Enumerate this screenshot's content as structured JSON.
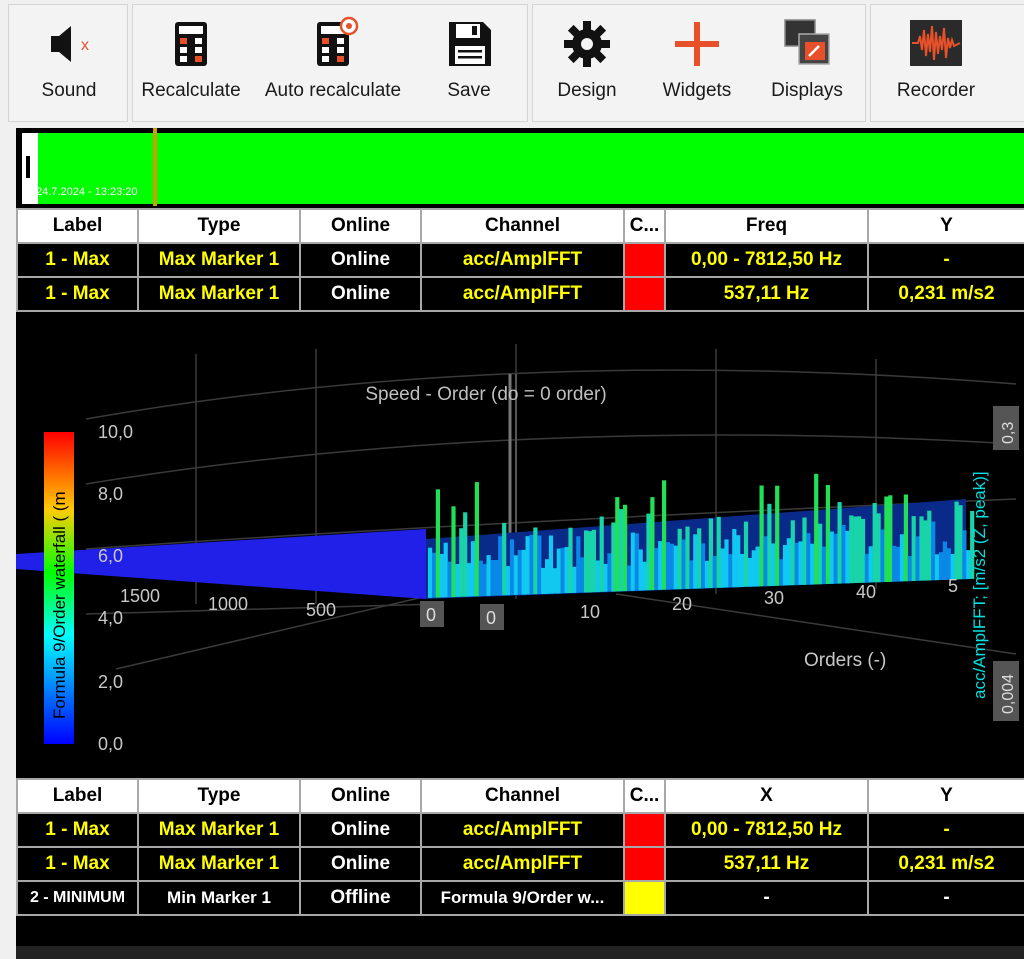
{
  "toolbar": {
    "sound": "Sound",
    "recalculate": "Recalculate",
    "auto_recalculate": "Auto recalculate",
    "save": "Save",
    "design": "Design",
    "widgets": "Widgets",
    "displays": "Displays",
    "recorder": "Recorder"
  },
  "timeline": {
    "timestamp": "24.7.2024 - 13:23:20"
  },
  "top_table": {
    "headers": [
      "Label",
      "Type",
      "Online",
      "Channel",
      "C...",
      "Freq",
      "Y"
    ],
    "rows": [
      {
        "label": "1 - Max",
        "type": "Max Marker 1",
        "online": "Online",
        "channel": "acc/AmplFFT",
        "color": "#ff0000",
        "freq": "0,00 - 7812,50 Hz",
        "y": "-"
      },
      {
        "label": "1 - Max",
        "type": "Max Marker 1",
        "online": "Online",
        "channel": "acc/AmplFFT",
        "color": "#ff0000",
        "freq": "537,11 Hz",
        "y": "0,231 m/s2"
      }
    ]
  },
  "plot": {
    "title": "Speed - Order (do = 0 order)",
    "left_axis_label": "Formula 9/Order waterfall ( (m",
    "left_ticks": [
      "10,0",
      "8,0",
      "6,0",
      "4,0",
      "2,0",
      "0,0"
    ],
    "right_axis_label": "acc/AmplFFT; [m/s2 (Z, peak)]",
    "right_top": "0,3",
    "right_bottom": "0,004",
    "speed_ticks": [
      "1500",
      "1000",
      "500"
    ],
    "order_ticks": [
      "10",
      "20",
      "30",
      "40",
      "5"
    ],
    "zero_a": "0",
    "zero_b": "0",
    "orders_label": "Orders (-)"
  },
  "bottom_table": {
    "headers": [
      "Label",
      "Type",
      "Online",
      "Channel",
      "C...",
      "X",
      "Y"
    ],
    "rows": [
      {
        "label": "1 - Max",
        "type": "Max Marker 1",
        "online": "Online",
        "channel": "acc/AmplFFT",
        "color": "#ff0000",
        "x": "0,00 - 7812,50 Hz",
        "y": "-"
      },
      {
        "label": "1 - Max",
        "type": "Max Marker 1",
        "online": "Online",
        "channel": "acc/AmplFFT",
        "color": "#ff0000",
        "x": "537,11 Hz",
        "y": "0,231 m/s2"
      },
      {
        "label": "2 - MINIMUM",
        "type": "Min Marker 1",
        "online": "Offline",
        "channel": "Formula 9/Order w...",
        "color": "#ffff00",
        "x": "-",
        "y": "-"
      }
    ]
  },
  "colors": {
    "marker_text": "#ffff00",
    "timeline": "#00ff00",
    "accent": "#e8502a"
  }
}
